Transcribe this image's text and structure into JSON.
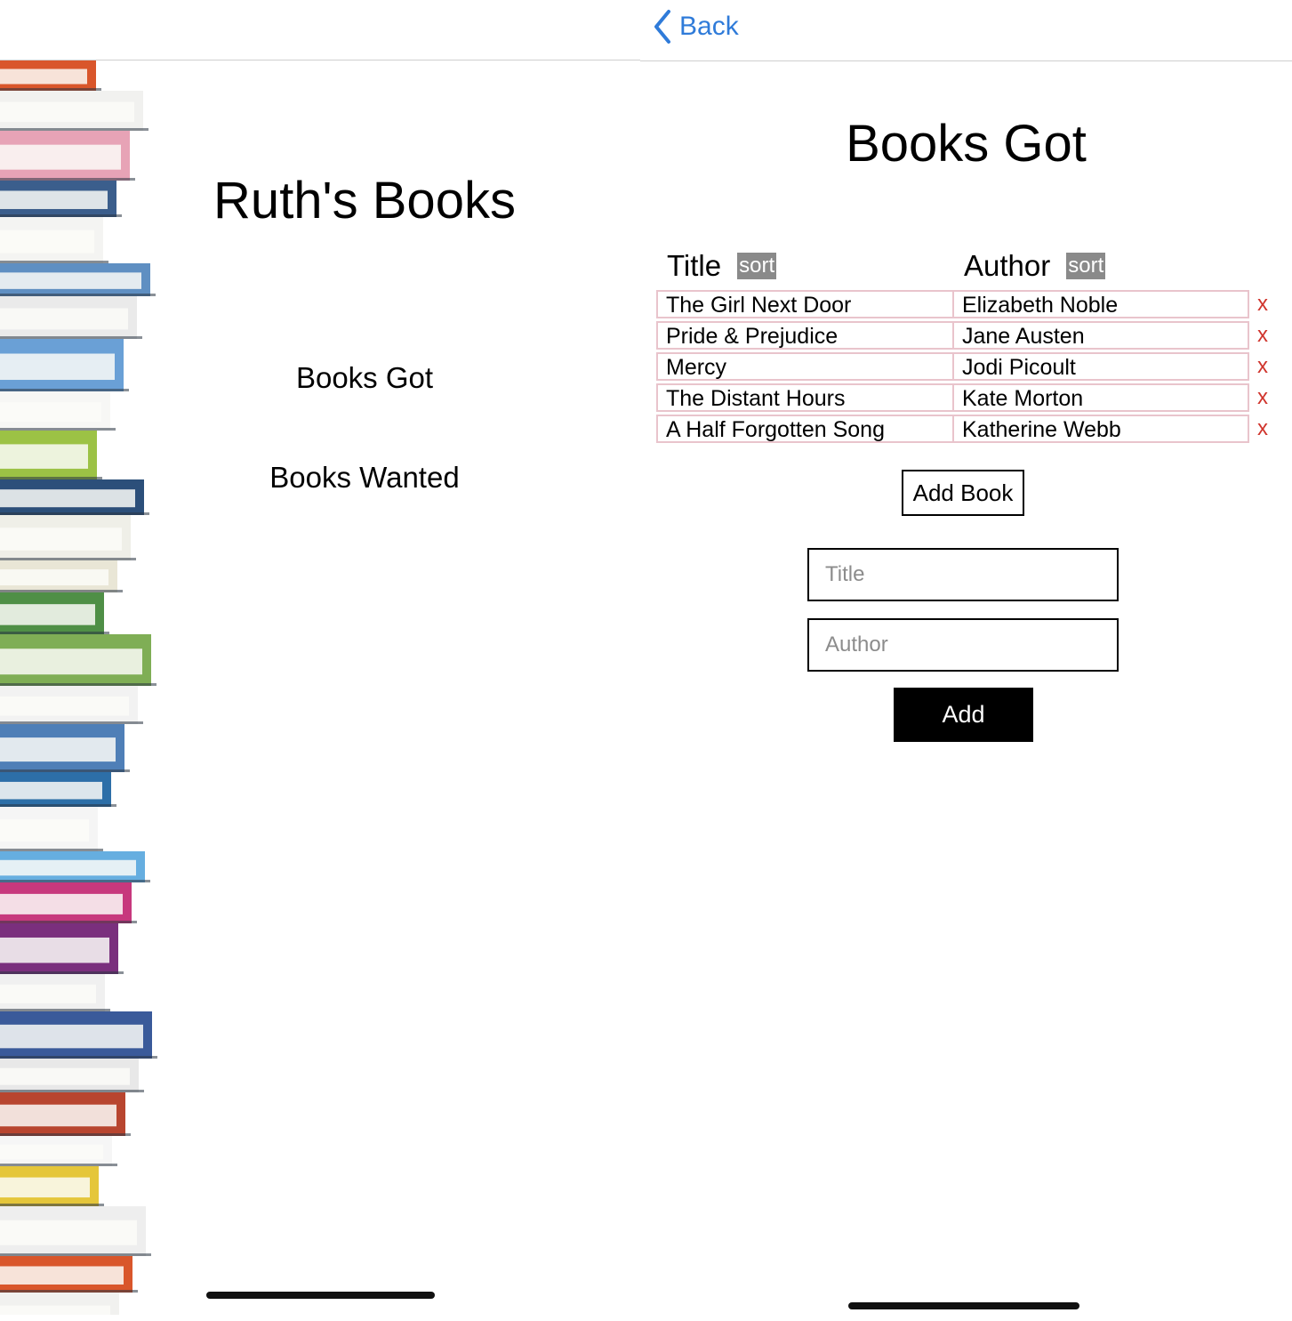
{
  "home": {
    "title": "Ruth's Books",
    "links": [
      "Books Got",
      "Books Wanted"
    ]
  },
  "books_got": {
    "back_label": "Back",
    "title": "Books Got",
    "columns": {
      "title": "Title",
      "author": "Author"
    },
    "sort_label": "sort",
    "delete_label": "x",
    "rows": [
      {
        "title": "The Girl Next Door",
        "author": "Elizabeth Noble"
      },
      {
        "title": "Pride & Prejudice",
        "author": "Jane Austen"
      },
      {
        "title": "Mercy",
        "author": "Jodi Picoult"
      },
      {
        "title": "The Distant Hours",
        "author": "Kate Morton"
      },
      {
        "title": "A Half Forgotten Song",
        "author": "Katherine Webb"
      }
    ],
    "add_book_label": "Add Book",
    "form": {
      "title_placeholder": "Title",
      "author_placeholder": "Author",
      "submit_label": "Add"
    }
  },
  "colors": {
    "link_blue": "#2f7bd9",
    "delete_red": "#d0342c",
    "row_border": "#e9c4cc",
    "sort_bg": "#8a8a8a"
  },
  "icons": {
    "back": "chevron-left-icon",
    "decor": "book-stack-image"
  }
}
